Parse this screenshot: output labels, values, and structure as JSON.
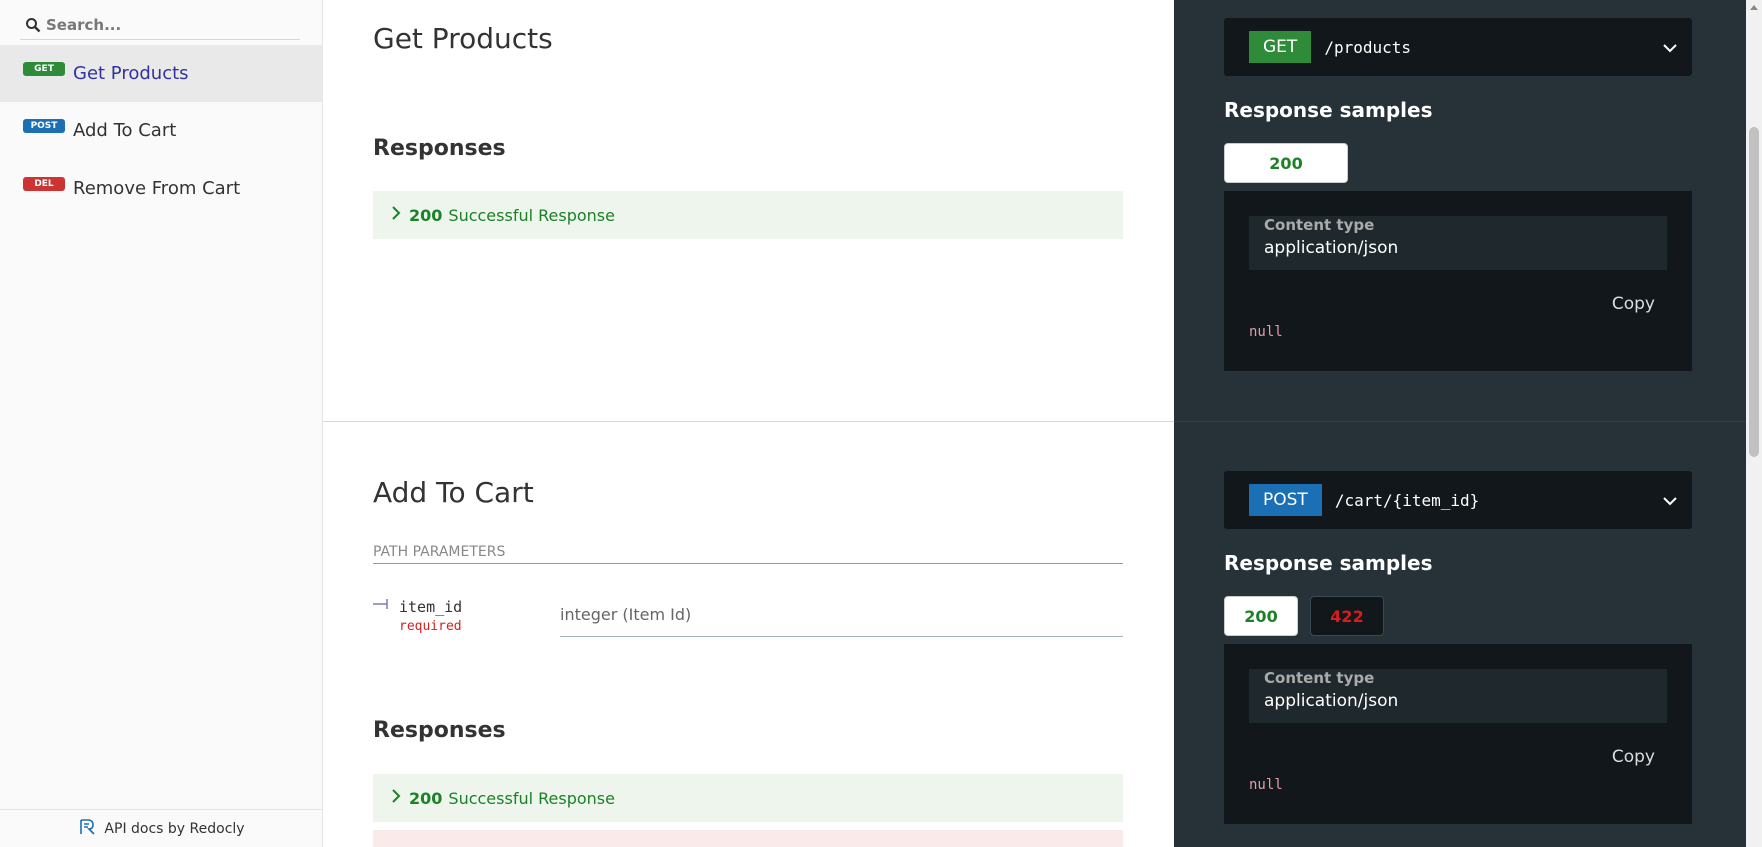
{
  "sidebar": {
    "search_placeholder": "Search...",
    "items": [
      {
        "method": "GET",
        "label": "Get Products"
      },
      {
        "method": "POST",
        "label": "Add To Cart"
      },
      {
        "method": "DEL",
        "label": "Remove From Cart"
      }
    ],
    "footer": "API docs by Redocly"
  },
  "ops": [
    {
      "title": "Get Products",
      "responses_heading": "Responses",
      "responses": [
        {
          "code": "200",
          "desc": "Successful Response"
        }
      ],
      "method": "GET",
      "path": "/products",
      "samples_title": "Response samples",
      "tabs": [
        "200"
      ],
      "content_type_label": "Content type",
      "content_type": "application/json",
      "copy": "Copy",
      "sample": "null"
    },
    {
      "title": "Add To Cart",
      "params_heading": "PATH PARAMETERS",
      "param": {
        "name": "item_id",
        "required": "required",
        "type": "integer (Item Id)"
      },
      "responses_heading": "Responses",
      "responses": [
        {
          "code": "200",
          "desc": "Successful Response"
        }
      ],
      "method": "POST",
      "path": "/cart/{item_id}",
      "samples_title": "Response samples",
      "tabs": [
        "200",
        "422"
      ],
      "content_type_label": "Content type",
      "content_type": "application/json",
      "copy": "Copy",
      "sample": "null"
    }
  ],
  "colors": {
    "get": "#2e8b3a",
    "post": "#1a6fb5",
    "del": "#cc3333",
    "success": "#1d8127",
    "panel": "#263238"
  }
}
